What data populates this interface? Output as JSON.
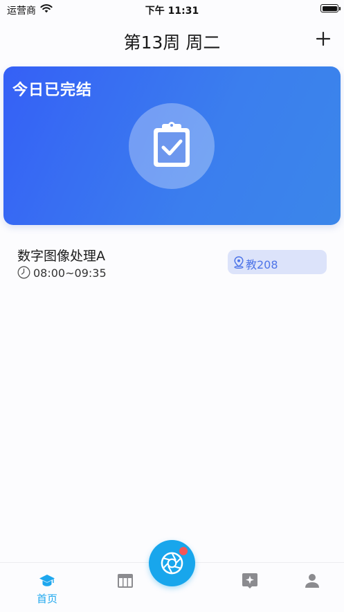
{
  "status_bar": {
    "carrier": "运营商",
    "time": "下午 11:31"
  },
  "header": {
    "title": "第13周 周二",
    "add_icon": "plus-icon"
  },
  "status_card": {
    "title": "今日已完结",
    "icon": "clipboard-check-icon",
    "gradient_start": "#3560f6",
    "gradient_end": "#3b86ea"
  },
  "courses": [
    {
      "name": "数字图像处理A",
      "time": "08:00~09:35",
      "location": "教208"
    }
  ],
  "tab_bar": {
    "accent": "#1ea7ee",
    "tabs": [
      {
        "icon": "graduation-cap-icon",
        "label": "首页",
        "active": true
      },
      {
        "icon": "schedule-table-icon",
        "label": "",
        "active": false
      },
      {
        "icon": "camera-aperture-icon",
        "label": "",
        "active": false
      },
      {
        "icon": "sparkle-badge-icon",
        "label": "",
        "active": false
      },
      {
        "icon": "person-icon",
        "label": "",
        "active": false
      }
    ]
  }
}
